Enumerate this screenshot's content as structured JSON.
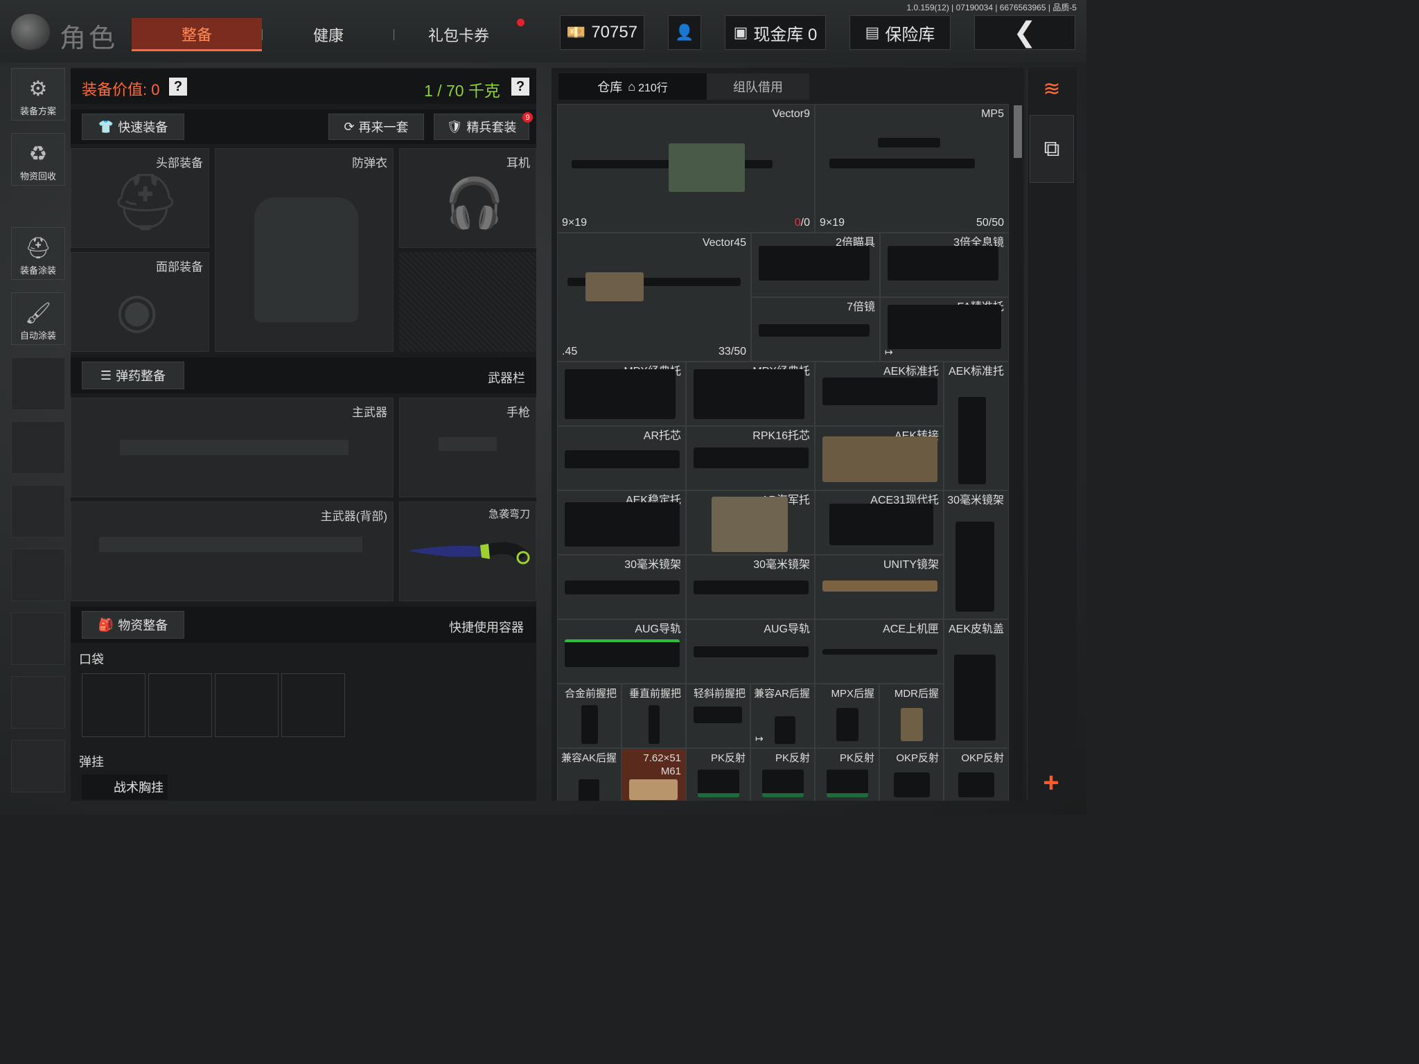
{
  "version": "1.0.159(12) | 07190034 | 6676563965 | 品质-5",
  "header": {
    "title": "角色",
    "tabs": [
      {
        "label": "整备",
        "active": true
      },
      {
        "label": "健康",
        "active": false
      },
      {
        "label": "礼包卡券",
        "active": false
      }
    ],
    "currency": "70757",
    "cash_vault": "现金库 0",
    "safe_box": "保险库",
    "colors": {
      "accent": "#ff6a3a",
      "tab_active_bg": "#7a2d1e",
      "notice_dot": "#e3232b"
    }
  },
  "sidebar": [
    {
      "label": "装备方案",
      "icon": "gun-cog-icon"
    },
    {
      "label": "物资回收",
      "icon": "recycle-face-icon"
    },
    {
      "label": "装备涂装",
      "icon": "helmet-paint-icon"
    },
    {
      "label": "自动涂装",
      "icon": "brush-gear-icon"
    }
  ],
  "equipment": {
    "value_label": "装备价值: 0",
    "weight": "1 / 70 千克",
    "quick_equip": "快速装备",
    "again_set": "再来一套",
    "elite_set": "精兵套装",
    "elite_badge": "9",
    "slots": {
      "head": "头部装备",
      "vest": "防弹衣",
      "headset": "耳机",
      "face": "面部装备"
    },
    "ammo_equip": "弹药整备",
    "weapon_bar": "武器栏",
    "primary": "主武器",
    "pistol": "手枪",
    "primary_back": "主武器(背部)",
    "melee": "急袭弯刀",
    "supply_equip": "物资整备",
    "quick_container": "快捷使用容器",
    "pocket": "口袋",
    "rig": "弹挂",
    "rig_item": "战术胸挂"
  },
  "inventory": {
    "tab_warehouse": "仓库",
    "tab_rows": "210行",
    "tab_team": "组队借用",
    "items": [
      {
        "name": "Vector9",
        "cal": "9×19",
        "ammo_cur": "0",
        "ammo_max": "/0"
      },
      {
        "name": "MP5",
        "cal": "9×19",
        "ammo": "50/50"
      },
      {
        "name": "Vector45",
        "cal": ".45",
        "ammo": "33/50"
      },
      {
        "name": "2倍瞄具"
      },
      {
        "name": "3倍全息镜"
      },
      {
        "name": "7倍镜"
      },
      {
        "name": "FA精准托"
      },
      {
        "name": "MPX经典托"
      },
      {
        "name": "MPX经典托"
      },
      {
        "name": "AEK标准托"
      },
      {
        "name": "AEK标准托"
      },
      {
        "name": "AR托芯"
      },
      {
        "name": "RPK16托芯"
      },
      {
        "name": "AEK转接"
      },
      {
        "name": "AEK稳定托"
      },
      {
        "name": "AR海军托"
      },
      {
        "name": "ACE31现代托"
      },
      {
        "name": "30毫米镜架"
      },
      {
        "name": "30毫米镜架"
      },
      {
        "name": "30毫米镜架"
      },
      {
        "name": "UNITY镜架"
      },
      {
        "name": "AUG导轨"
      },
      {
        "name": "AUG导轨"
      },
      {
        "name": "ACE上机匣"
      },
      {
        "name": "AEK皮轨盖"
      },
      {
        "name": "合金前握把"
      },
      {
        "name": "垂直前握把"
      },
      {
        "name": "轻斜前握把"
      },
      {
        "name": "兼容AR后握"
      },
      {
        "name": "MPX后握"
      },
      {
        "name": "MDR后握"
      },
      {
        "name": "兼容AK后握"
      },
      {
        "name": "7.62×51 M61"
      },
      {
        "name": "PK反射"
      },
      {
        "name": "PK反射"
      },
      {
        "name": "PK反射"
      },
      {
        "name": "OKP反射"
      },
      {
        "name": "OKP反射"
      }
    ]
  }
}
